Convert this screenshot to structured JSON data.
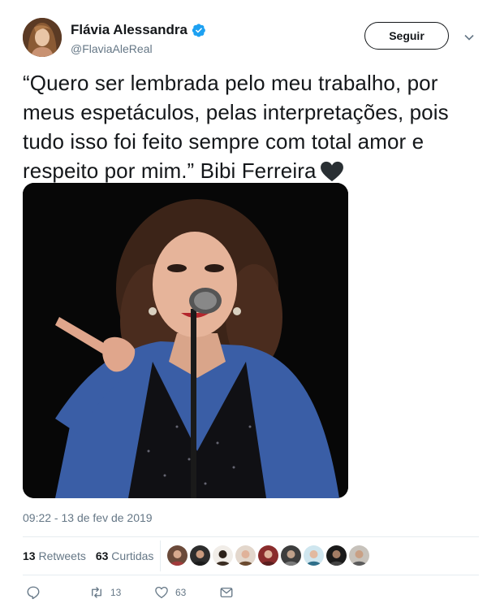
{
  "user": {
    "display_name": "Flávia Alessandra",
    "handle": "@FlaviaAleReal",
    "verified": true
  },
  "follow_button": {
    "label": "Seguir"
  },
  "tweet": {
    "text": "“Quero ser lembrada pelo meu trabalho, por meus espetáculos, pelas interpretações, pois tudo isso foi feito sempre com total amor e respeito por mim.” Bibi Ferreira",
    "emoji": "black-heart-icon",
    "timestamp": "09:22 - 13 de fev de 2019"
  },
  "stats": {
    "retweets_count": "13",
    "retweets_label": "Retweets",
    "likes_count": "63",
    "likes_label": "Curtidas",
    "liker_avatar_count_shown": 9
  },
  "actions": {
    "reply_icon": "reply-icon",
    "retweet_icon": "retweet-icon",
    "retweet_count": "13",
    "like_icon": "heart-icon",
    "like_count": "63",
    "dm_icon": "envelope-icon"
  },
  "colors": {
    "text_primary": "#14171a",
    "text_secondary": "#657786",
    "verified_blue": "#1da1f2",
    "divider": "#e6ecf0"
  }
}
